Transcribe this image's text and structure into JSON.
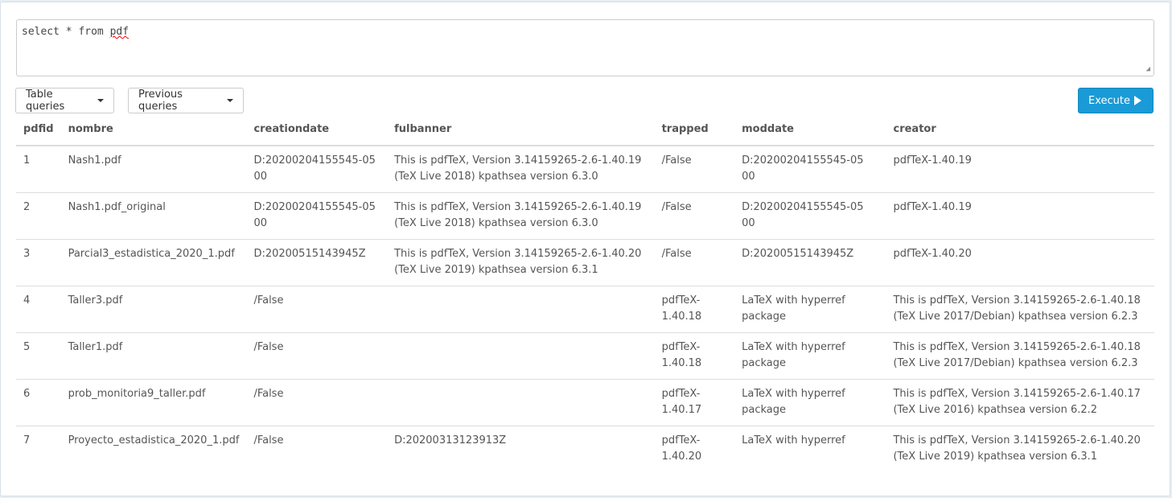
{
  "query": {
    "prefix": "select * from ",
    "misspelled": "pdf"
  },
  "buttons": {
    "table_queries": "Table queries",
    "previous_queries": "Previous queries",
    "execute": "Execute"
  },
  "table": {
    "columns": [
      "pdfid",
      "nombre",
      "creationdate",
      "fulbanner",
      "trapped",
      "moddate",
      "creator"
    ],
    "rows": [
      [
        "1",
        "Nash1.pdf",
        "D:20200204155545-05 00",
        "This is pdfTeX, Version 3.14159265-2.6-1.40.19 (TeX Live 2018) kpathsea version 6.3.0",
        "/False",
        "D:20200204155545-05 00",
        "pdfTeX-1.40.19"
      ],
      [
        "2",
        "Nash1.pdf_original",
        "D:20200204155545-05 00",
        "This is pdfTeX, Version 3.14159265-2.6-1.40.19 (TeX Live 2018) kpathsea version 6.3.0",
        "/False",
        "D:20200204155545-05 00",
        "pdfTeX-1.40.19"
      ],
      [
        "3",
        "Parcial3_estadistica_2020_1.pdf",
        "D:20200515143945Z",
        "This is pdfTeX, Version 3.14159265-2.6-1.40.20 (TeX Live 2019) kpathsea version 6.3.1",
        "/False",
        "D:20200515143945Z",
        "pdfTeX-1.40.20"
      ],
      [
        "4",
        "Taller3.pdf",
        "/False",
        "",
        "pdfTeX-1.40.18",
        "LaTeX with hyperref package",
        "This is pdfTeX, Version 3.14159265-2.6-1.40.18 (TeX Live 2017/Debian) kpathsea version 6.2.3"
      ],
      [
        "5",
        "Taller1.pdf",
        "/False",
        "",
        "pdfTeX-1.40.18",
        "LaTeX with hyperref package",
        "This is pdfTeX, Version 3.14159265-2.6-1.40.18 (TeX Live 2017/Debian) kpathsea version 6.2.3"
      ],
      [
        "6",
        "prob_monitoria9_taller.pdf",
        "/False",
        "",
        "pdfTeX-1.40.17",
        "LaTeX with hyperref package",
        "This is pdfTeX, Version 3.14159265-2.6-1.40.17 (TeX Live 2016) kpathsea version 6.2.2"
      ],
      [
        "7",
        "Proyecto_estadistica_2020_1.pdf",
        "/False",
        "D:20200313123913Z",
        "pdfTeX-1.40.20",
        "LaTeX with hyperref",
        "This is pdfTeX, Version 3.14159265-2.6-1.40.20 (TeX Live 2019) kpathsea version 6.3.1"
      ]
    ]
  }
}
